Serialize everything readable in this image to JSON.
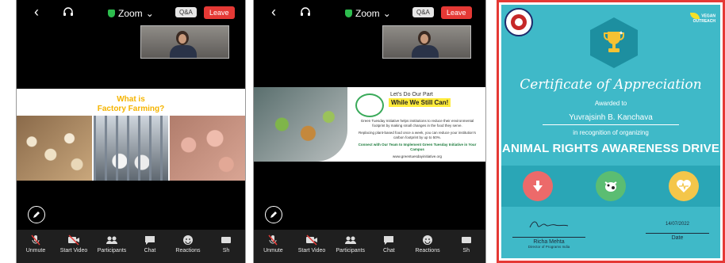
{
  "panels": {
    "left": {
      "topbar": {
        "title": "Zoom",
        "qa": "Q&A",
        "leave": "Leave"
      },
      "slide": {
        "title_line1": "What is",
        "title_line2": "Factory Farming?"
      },
      "toolbar": [
        "Unmute",
        "Start Video",
        "Participants",
        "Chat",
        "Reactions",
        "Sh"
      ]
    },
    "middle": {
      "topbar": {
        "title": "Zoom",
        "qa": "Q&A",
        "leave": "Leave"
      },
      "slide": {
        "line1": "Let's Do Our Part",
        "line2": "While We Still Can!",
        "para1": "Green Tuesday Initiative helps institutions to reduce their environmental footprint by making small changes in the food they serve.",
        "para2": "Replacing plant-based food once a week, you can reduce your institution's carbon footprint by up to 50%.",
        "para3": "Connect with Our Team to Implement Green Tuesday Initiative in Your Campus",
        "footer": "www.greentuesdayinitiative.org"
      },
      "toolbar": [
        "Unmute",
        "Start Video",
        "Participants",
        "Chat",
        "Reactions",
        "Sh"
      ]
    }
  },
  "certificate": {
    "title": "Certificate of Appreciation",
    "awarded_to": "Awarded to",
    "recipient": "Yuvrajsinh B. Kanchava",
    "recognition": "in recognition of organizing",
    "event": "ANIMAL RIGHTS AWARENESS DRIVE",
    "logo_right_line1": "VEGAN",
    "logo_right_line2": "OUTREACH",
    "signatory_name": "Richa Mehta",
    "signatory_role": "Director of Programs India",
    "date_value": "14/07/2022",
    "date_label": "Date"
  },
  "colors": {
    "cert_teal": "#3fb9c8",
    "highlight_border": "#e53935",
    "leave_red": "#e53935",
    "slide_title": "#f5b400"
  }
}
